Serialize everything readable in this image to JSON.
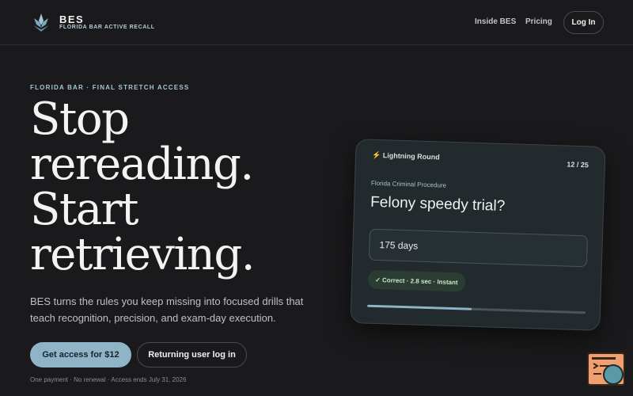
{
  "header": {
    "brand": "BES",
    "brand_subtitle": "FLORIDA BAR ACTIVE RECALL",
    "logo_icon": "lotus-icon",
    "nav": {
      "inside": "Inside BES",
      "pricing": "Pricing",
      "login": "Log In"
    }
  },
  "hero": {
    "eyebrow": "FLORIDA BAR · FINAL STRETCH ACCESS",
    "title_lines": [
      "Stop",
      "rereading.",
      "Start",
      "retrieving."
    ],
    "description": "BES turns the rules you keep missing into focused drills that teach recognition, precision, and exam-day execution.",
    "cta_primary": "Get access for $12",
    "cta_secondary": "Returning user log in",
    "fine_print": "One payment · No renewal · Access ends July 31, 2026"
  },
  "card": {
    "round_label": "⚡ Lightning Round",
    "counter": "12 / 25",
    "category": "Florida Criminal Procedure",
    "question": "Felony speedy trial?",
    "answer": "175 days",
    "result": "✓ Correct · 2.8 sec · Instant",
    "progress_fraction": 0.48
  },
  "widget": {
    "icon": "feedback-widget-icon"
  },
  "colors": {
    "background": "#1a1a1c",
    "accent": "#8fb4c6",
    "card": "#222a2d",
    "success_bg": "#2b3d33"
  }
}
